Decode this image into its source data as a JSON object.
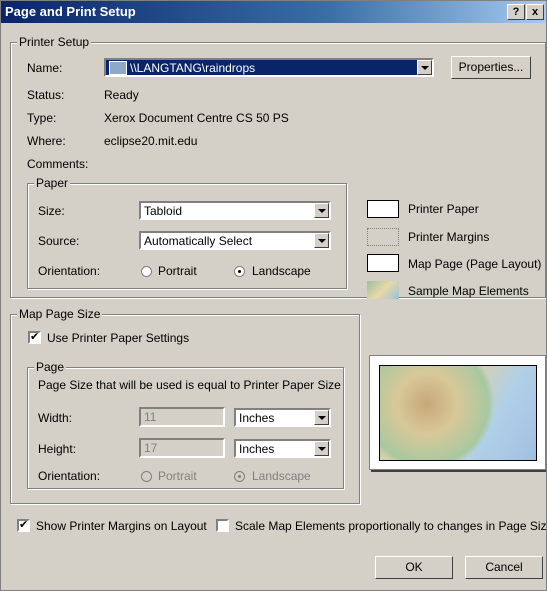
{
  "window": {
    "title": "Page and Print Setup",
    "help_btn": "?",
    "close_btn": "x"
  },
  "printer_setup": {
    "legend": "Printer Setup",
    "name_label": "Name:",
    "name_value": "\\\\LANGTANG\\raindrops",
    "properties_btn": "Properties...",
    "status_label": "Status:",
    "status_value": "Ready",
    "type_label": "Type:",
    "type_value": "Xerox Document Centre CS 50 PS",
    "where_label": "Where:",
    "where_value": "eclipse20.mit.edu",
    "comments_label": "Comments:",
    "paper": {
      "legend": "Paper",
      "size_label": "Size:",
      "size_value": "Tabloid",
      "source_label": "Source:",
      "source_value": "Automatically Select",
      "orientation_label": "Orientation:",
      "portrait": "Portrait",
      "landscape": "Landscape",
      "selected": "Landscape"
    }
  },
  "legend_panel": {
    "printer_paper": "Printer Paper",
    "printer_margins": "Printer Margins",
    "map_page": "Map Page (Page Layout)",
    "sample_map": "Sample Map Elements"
  },
  "map_page_size": {
    "legend": "Map Page Size",
    "use_printer_settings": "Use Printer Paper Settings",
    "use_printer_checked": true,
    "page": {
      "legend": "Page",
      "info": "Page Size that will be used is equal to Printer Paper Size",
      "width_label": "Width:",
      "width_value": "11",
      "width_unit": "Inches",
      "height_label": "Height:",
      "height_value": "17",
      "height_unit": "Inches",
      "orientation_label": "Orientation:",
      "portrait": "Portrait",
      "landscape": "Landscape"
    }
  },
  "options": {
    "show_margins": "Show Printer Margins on Layout",
    "show_margins_checked": true,
    "scale_elements": "Scale Map Elements proportionally to changes in Page Size",
    "scale_elements_checked": false
  },
  "buttons": {
    "ok": "OK",
    "cancel": "Cancel"
  }
}
